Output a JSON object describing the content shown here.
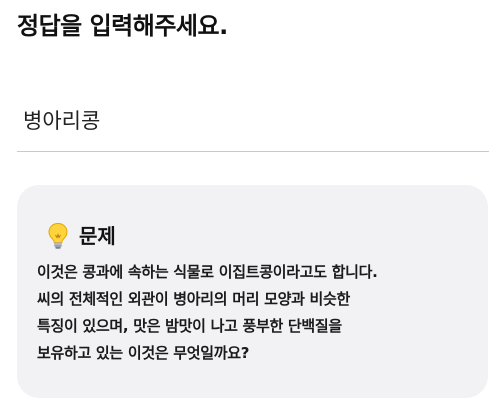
{
  "heading": "정답을 입력해주세요.",
  "answer": {
    "value": "병아리콩"
  },
  "problem": {
    "icon": "lightbulb-icon",
    "title": "문제",
    "lines": [
      "이것은 콩과에 속하는 식물로 이집트콩이라고도 합니다.",
      "씨의 전체적인 외관이 병아리의 머리 모양과 비슷한",
      "특징이 있으며, 맛은 밤맛이 나고 풍부한 단백질을",
      "보유하고 있는 이것은 무엇일까요?"
    ]
  },
  "colors": {
    "card_background": "#f2f2f4",
    "divider": "#c9c9c9",
    "text": "#111111"
  }
}
